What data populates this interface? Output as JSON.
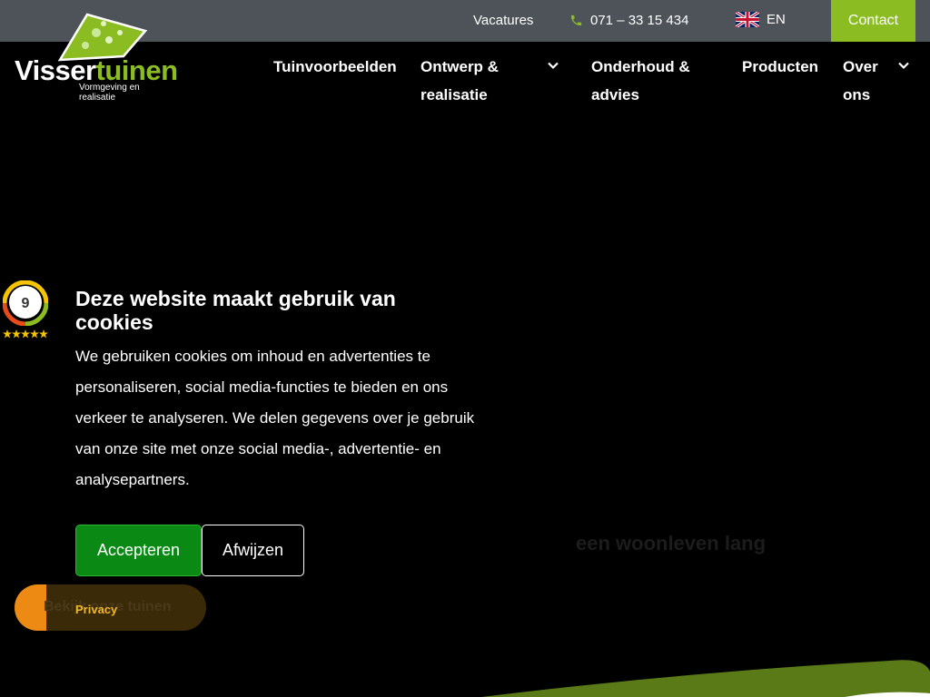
{
  "topbar": {
    "vacatures": "Vacatures",
    "phone": "071 – 33 15 434",
    "language": "EN",
    "contact": "Contact"
  },
  "logo": {
    "name_part1": "Visser",
    "name_part2": "tuinen",
    "tagline": "Vormgeving en realisatie"
  },
  "nav": {
    "items": [
      {
        "label": "Tuinvoorbeelden"
      },
      {
        "label": "Ontwerp & realisatie"
      },
      {
        "label": "Onderhoud & advies"
      },
      {
        "label": "Producten"
      },
      {
        "label": "Over ons"
      }
    ]
  },
  "rating": {
    "score": "9"
  },
  "cookie": {
    "title": "Deze website maakt gebruik van cookies",
    "text": "We gebruiken cookies om inhoud en advertenties te personaliseren, social media-functies te bieden en ons verkeer te analyseren. We delen gegevens over je gebruik van onze site met onze social media-, advertentie- en analysepartners.",
    "accept": "Accepteren",
    "reject": "Afwijzen"
  },
  "hero": {
    "slogan": "een woonleven lang",
    "cta": "Bekijk onze tuinen"
  },
  "privacy": "Privacy",
  "colors": {
    "topbar": "#4d5358",
    "brand_green": "#8bbd23",
    "accept_green": "#0a8a15",
    "orange": "#ec8a14",
    "background": "#000000"
  },
  "icons": [
    "phone-icon",
    "uk-flag-icon",
    "chevron-down-icon",
    "star-icon"
  ]
}
